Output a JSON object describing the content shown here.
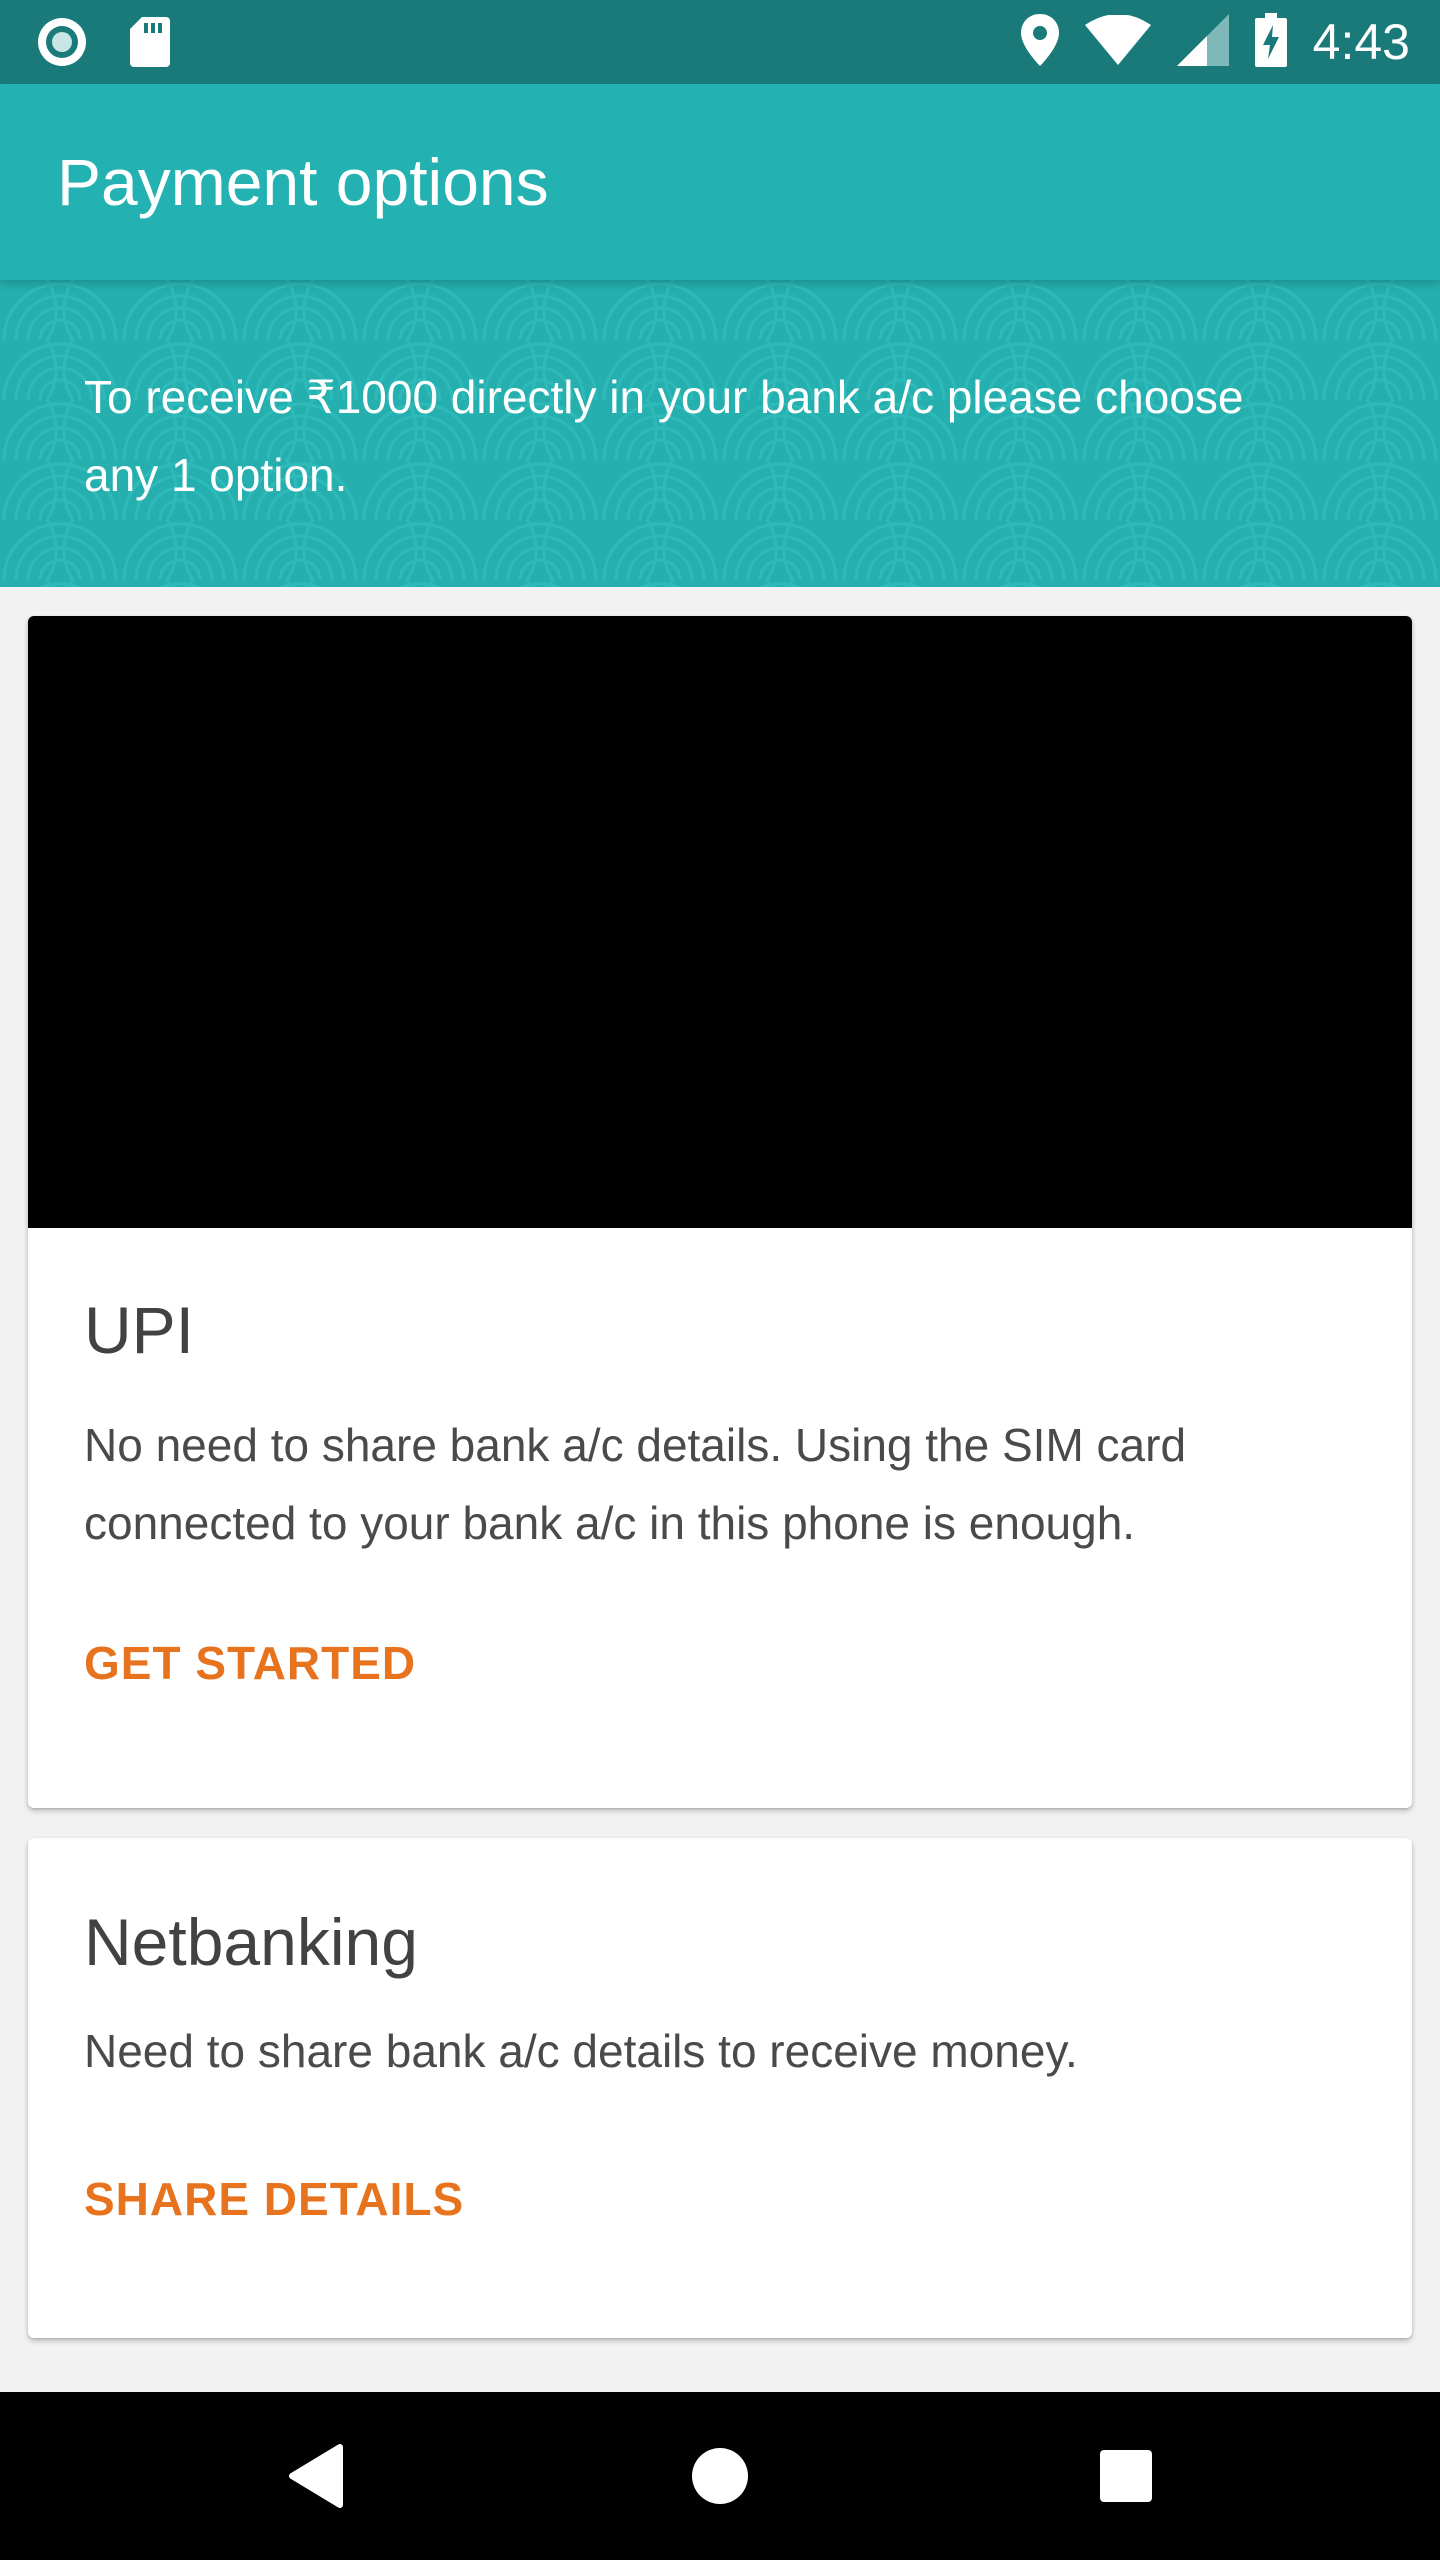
{
  "status_bar": {
    "time": "4:43",
    "icons": [
      "circle-notification-icon",
      "sd-card-icon",
      "location-icon",
      "wifi-icon",
      "signal-icon",
      "battery-charging-icon"
    ]
  },
  "app_bar": {
    "title": "Payment options"
  },
  "banner": {
    "text": "To receive ₹1000 directly in your bank a/c please choose any 1 option."
  },
  "options": [
    {
      "title": "UPI",
      "description": "No need to share bank a/c details. Using the SIM card connected to your bank a/c in this phone is enough.",
      "action": "GET STARTED"
    },
    {
      "title": "Netbanking",
      "description": "Need to share bank a/c details to receive money.",
      "action": "SHARE DETAILS"
    }
  ],
  "nav_bar": {
    "icons": [
      "back-icon",
      "home-icon",
      "recent-apps-icon"
    ]
  },
  "colors": {
    "status_bar": "#1a7a7a",
    "app_bar": "#24b1b1",
    "accent": "#e8731e",
    "background": "#f2f2f2"
  }
}
